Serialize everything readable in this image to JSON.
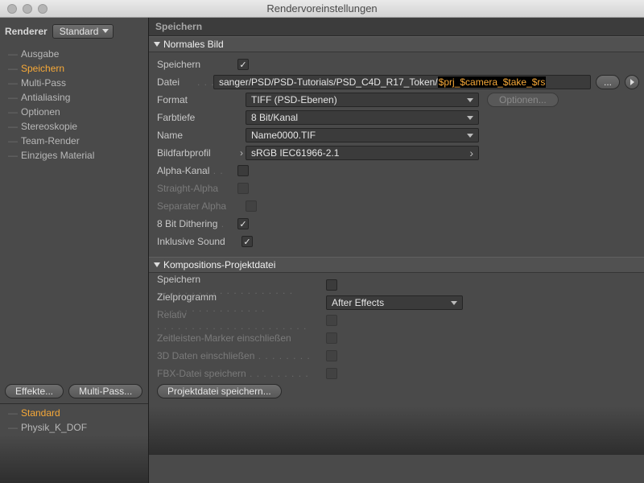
{
  "window": {
    "title": "Rendervoreinstellungen"
  },
  "sidebar": {
    "renderer_label": "Renderer",
    "renderer_value": "Standard",
    "items": [
      {
        "label": "Ausgabe",
        "selected": false
      },
      {
        "label": "Speichern",
        "selected": true
      },
      {
        "label": "Multi-Pass",
        "selected": false
      },
      {
        "label": "Antialiasing",
        "selected": false
      },
      {
        "label": "Optionen",
        "selected": false
      },
      {
        "label": "Stereoskopie",
        "selected": false
      },
      {
        "label": "Team-Render",
        "selected": false
      },
      {
        "label": "Einziges Material",
        "selected": false
      }
    ],
    "effects_btn": "Effekte...",
    "multipass_btn": "Multi-Pass...",
    "presets": [
      {
        "label": "Standard",
        "selected": true
      },
      {
        "label": "Physik_K_DOF",
        "selected": false
      }
    ]
  },
  "panel": {
    "title": "Speichern",
    "section1": {
      "header": "Normales Bild",
      "rows": {
        "speichern": {
          "label": "Speichern",
          "checked": true
        },
        "datei": {
          "label": "Datei",
          "value_plain": "sanger/PSD/PSD-Tutorials/PSD_C4D_R17_Token/",
          "value_hl": "$prj_$camera_$take_$rs"
        },
        "format": {
          "label": "Format",
          "value": "TIFF (PSD-Ebenen)",
          "options_btn": "Optionen..."
        },
        "farbtiefe": {
          "label": "Farbtiefe",
          "value": "8 Bit/Kanal"
        },
        "name": {
          "label": "Name",
          "value": "Name0000.TIF"
        },
        "bildfarbprofil": {
          "label": "Bildfarbprofil",
          "value": "sRGB IEC61966-2.1"
        },
        "alpha": {
          "label": "Alpha-Kanal",
          "checked": false
        },
        "straight": {
          "label": "Straight-Alpha",
          "checked": false
        },
        "separater": {
          "label": "Separater Alpha",
          "checked": false
        },
        "dithering": {
          "label": "8 Bit Dithering",
          "checked": true
        },
        "sound": {
          "label": "Inklusive Sound",
          "checked": true
        }
      }
    },
    "section2": {
      "header": "Kompositions-Projektdatei",
      "rows": {
        "speichern": {
          "label": "Speichern",
          "checked": false
        },
        "ziel": {
          "label": "Zielprogramm",
          "value": "After Effects"
        },
        "relativ": {
          "label": "Relativ",
          "checked": false
        },
        "zeitleisten": {
          "label": "Zeitleisten-Marker einschließen",
          "checked": false
        },
        "daten3d": {
          "label": "3D Daten einschließen",
          "checked": false
        },
        "fbx": {
          "label": "FBX-Datei speichern",
          "checked": false
        },
        "save_btn": "Projektdatei speichern..."
      }
    }
  }
}
